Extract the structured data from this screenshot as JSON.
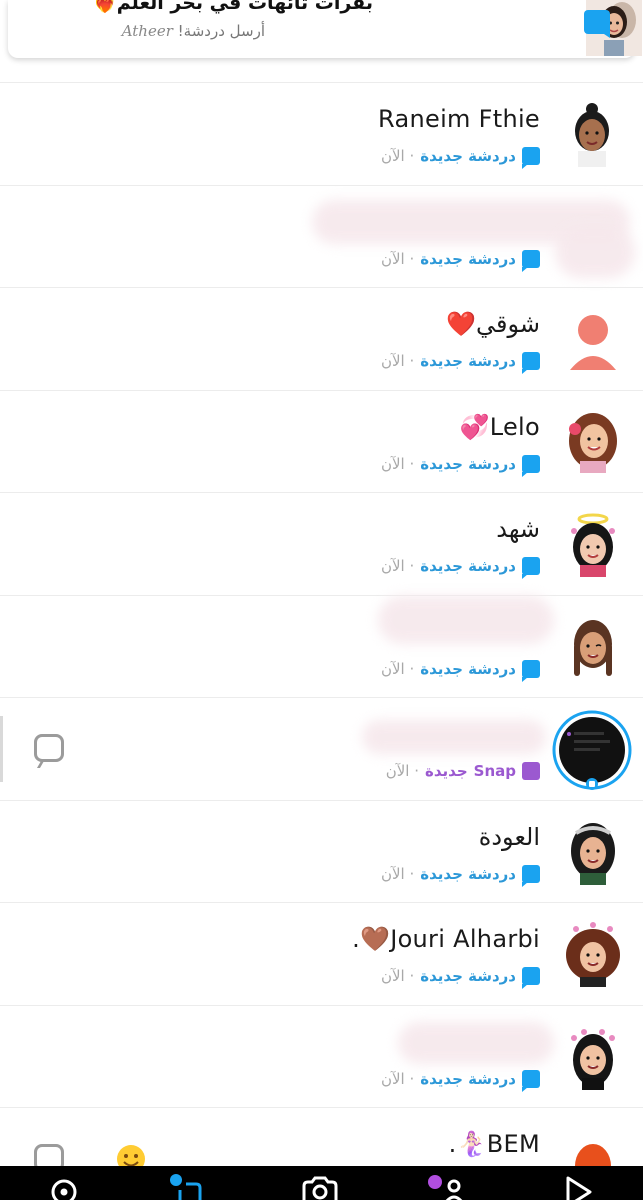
{
  "notification": {
    "title": "بقرات تائهات في بحر العلم❤️‍🔥",
    "subtitle_pre": "أرسل دردشة!",
    "subtitle_name": "Atheer"
  },
  "status_text": {
    "new_chat": "دردشة جديدة",
    "new_snap_word": "جديدة",
    "snap_word": "Snap",
    "time": "· الآن"
  },
  "chats": [
    {
      "name": "Raneim Fthie",
      "kind": "chat"
    },
    {
      "name": "",
      "kind": "chat"
    },
    {
      "name": "شوقي❤️",
      "kind": "chat"
    },
    {
      "name": "Lelo💞",
      "kind": "chat"
    },
    {
      "name": "شهد",
      "kind": "chat"
    },
    {
      "name": "",
      "kind": "chat"
    },
    {
      "name": "",
      "kind": "snap"
    },
    {
      "name": "العودة",
      "kind": "chat"
    },
    {
      "name": "Jouri Alharbi🤎.",
      "kind": "chat"
    },
    {
      "name": "",
      "kind": "chat"
    },
    {
      "name": "BEM🧜🏻‍♀️.",
      "kind": "chat"
    }
  ],
  "colors": {
    "chat_blue": "#1aa3f0",
    "snap_purple": "#9b59d0",
    "navbar": "#000000"
  },
  "nav_icons": [
    "map-icon",
    "chat-icon",
    "camera-icon",
    "stories-icon",
    "spotlight-icon"
  ]
}
